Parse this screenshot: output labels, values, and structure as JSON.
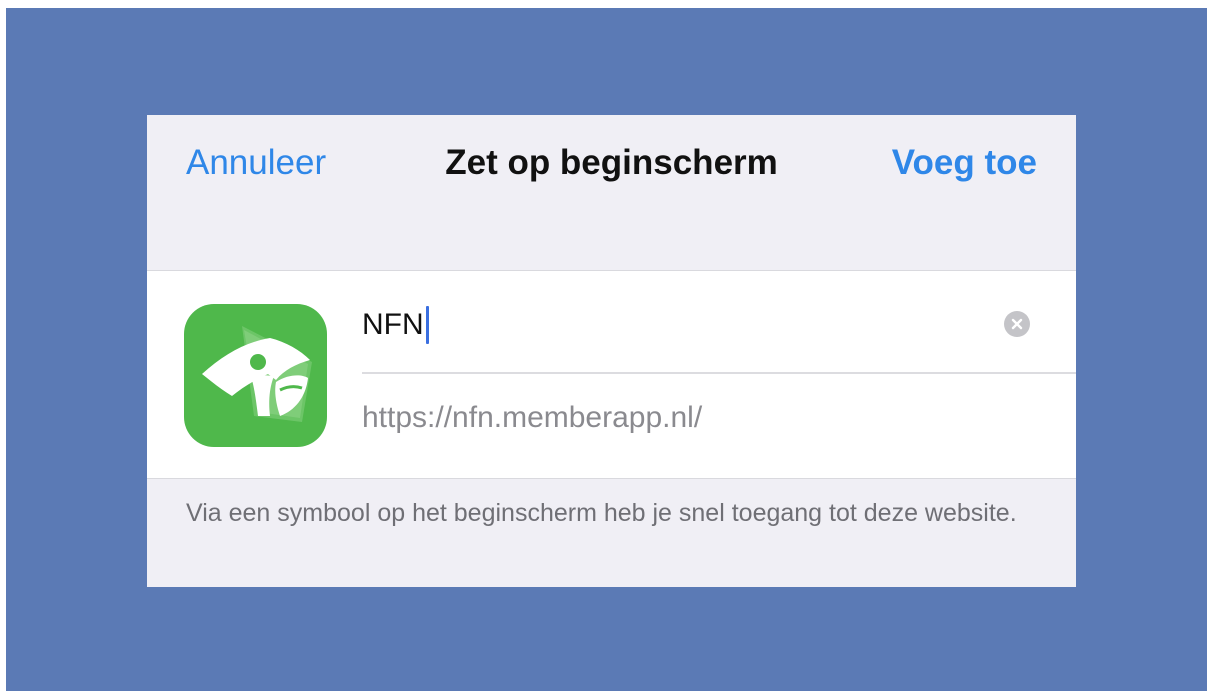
{
  "sheet": {
    "cancel_label": "Annuleer",
    "title": "Zet op beginscherm",
    "add_label": "Voeg toe"
  },
  "form": {
    "name_value": "NFN",
    "url": "https://nfn.memberapp.nl/",
    "clear_icon": "clear-circle-icon",
    "app_icon": "nfn-app-icon"
  },
  "footer": {
    "note": "Via een symbool op het beginscherm heb je snel toegang tot deze website."
  },
  "colors": {
    "backdrop": "#5b7ab5",
    "accent": "#2f87e8",
    "app_icon_green": "#4fb84b"
  }
}
